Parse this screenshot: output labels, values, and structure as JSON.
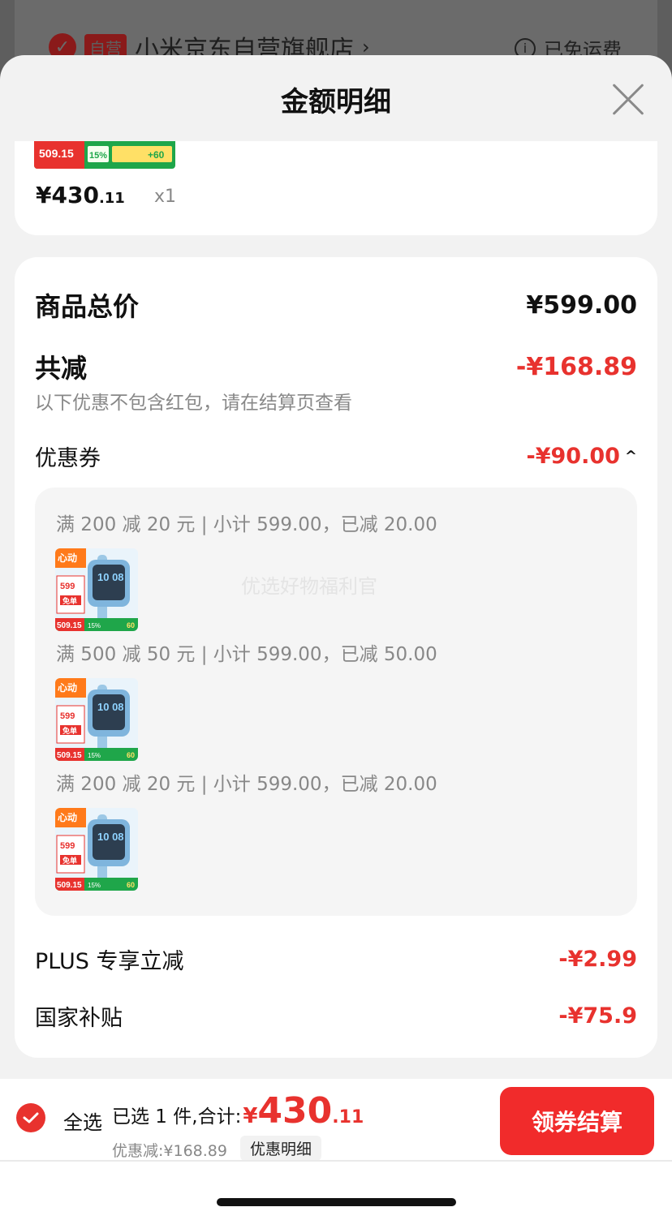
{
  "background": {
    "store_tag": "自营",
    "store_name": "小米京东自营旗舰店",
    "store_chevron": "›",
    "info_icon_glyph": "i",
    "shipping": "已免运费"
  },
  "sheet": {
    "title": "金额明细"
  },
  "product": {
    "strip_price": "509.15",
    "strip_badge": "15%",
    "strip_plus": "+60",
    "price_symbol": "¥",
    "price_int": "430",
    "price_dec": ".11",
    "quantity": "x1"
  },
  "details": {
    "total_label": "商品总价",
    "total_value": "¥599.00",
    "reduce_label": "共减",
    "reduce_value": "-¥168.89",
    "note": "以下优惠不包含红包，请在结算页查看",
    "coupon_label": "优惠券",
    "coupon_value": "-¥90.00",
    "coupon_caret": "^",
    "watermark": "优选好物福利官",
    "coupons": [
      {
        "text": "满 200 减 20 元 | 小计 599.00，已减 20.00"
      },
      {
        "text": "满 500 减 50 元 | 小计 599.00，已减 50.00"
      },
      {
        "text": "满 200 减 20 元 | 小计 599.00，已减 20.00"
      }
    ],
    "thumb_text": {
      "badge": "心动",
      "price": "599",
      "free": "免单",
      "bottom_price": "509.15",
      "bottom_badge": "15%",
      "bottom_plus": "60",
      "screen": "10 08"
    },
    "plus_label": "PLUS 专享立减",
    "plus_value": "-¥2.99",
    "subsidy_label": "国家补贴",
    "subsidy_value": "-¥75.9"
  },
  "bottom": {
    "select_all": "全选",
    "total_prefix": "已选 1 件,合计:",
    "total_yen": "¥",
    "total_int": "430",
    "total_dec": ".11",
    "discount": "优惠减:¥168.89",
    "detail_button": "优惠明细",
    "checkout_button": "领券结算"
  },
  "colors": {
    "accent_red": "#e8322e",
    "button_red": "#f12b2b"
  }
}
